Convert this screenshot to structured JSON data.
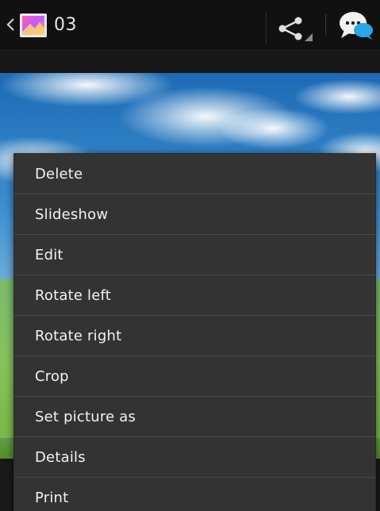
{
  "action_bar": {
    "title": "03",
    "nav_icon": "chevron-left-icon",
    "app_icon": "gallery-icon",
    "share_icon": "share-icon",
    "messaging_icon": "messaging-icon"
  },
  "menu": {
    "items": [
      {
        "label": "Delete"
      },
      {
        "label": "Slideshow"
      },
      {
        "label": "Edit"
      },
      {
        "label": "Rotate left"
      },
      {
        "label": "Rotate right"
      },
      {
        "label": "Crop"
      },
      {
        "label": "Set picture as"
      },
      {
        "label": "Details"
      },
      {
        "label": "Print"
      }
    ]
  },
  "colors": {
    "action_bar_bg": "#111111",
    "menu_bg": "#333333",
    "menu_divider": "#4a4a4a",
    "menu_text": "#f2f2f2",
    "sky_top": "#1d6fb8",
    "sky_bottom": "#5aa6dc",
    "grass": "#9ccc3a"
  }
}
